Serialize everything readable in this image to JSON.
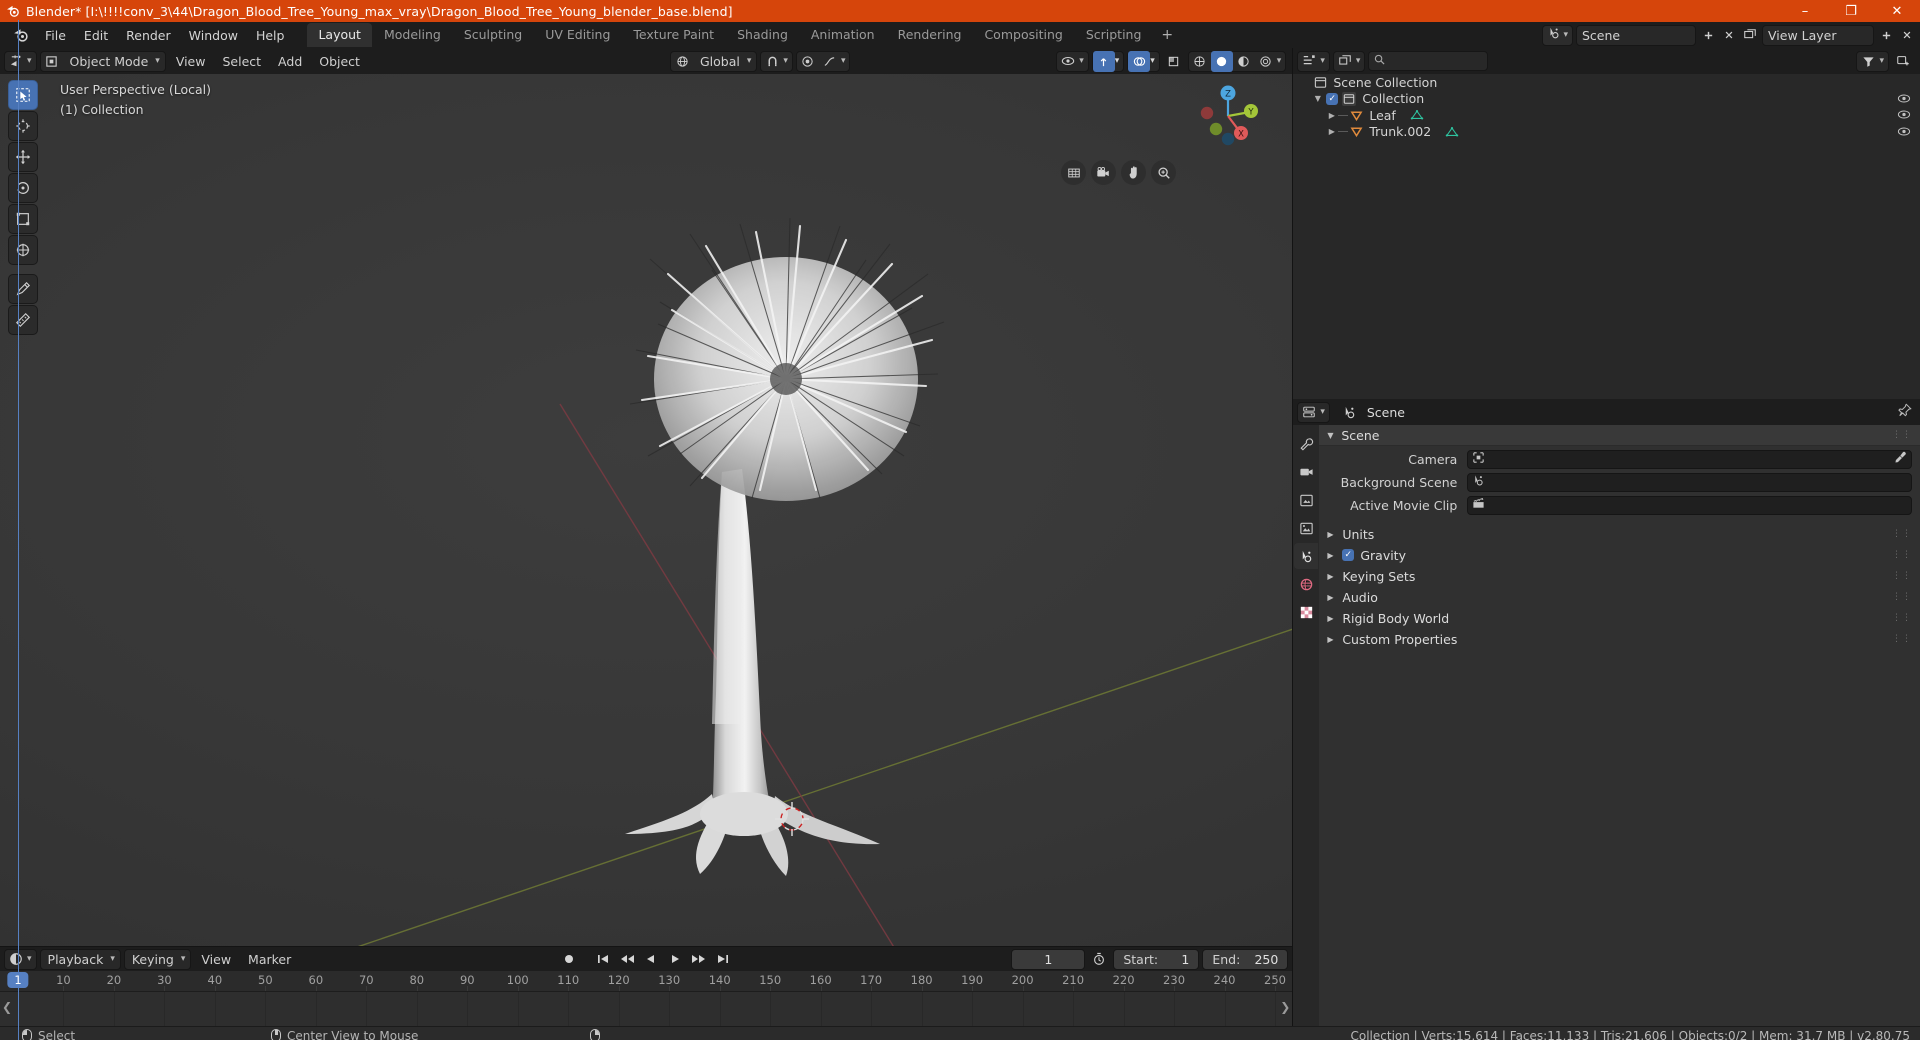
{
  "titlebar": {
    "title": "Blender* [I:\\!!!!conv_3\\44\\Dragon_Blood_Tree_Young_max_vray\\Dragon_Blood_Tree_Young_blender_base.blend]",
    "minimize": "–",
    "maximize": "❐",
    "close": "✕"
  },
  "topbar": {
    "menus": [
      "File",
      "Edit",
      "Render",
      "Window",
      "Help"
    ],
    "workspaces": [
      "Layout",
      "Modeling",
      "Sculpting",
      "UV Editing",
      "Texture Paint",
      "Shading",
      "Animation",
      "Rendering",
      "Compositing",
      "Scripting"
    ],
    "active_workspace": "Layout",
    "add_workspace": "+",
    "scene_name": "Scene",
    "view_layer_name": "View Layer",
    "new_scene": "➕",
    "unlink_scene": "✕"
  },
  "viewport": {
    "mode": "Object Mode",
    "menus": [
      "View",
      "Select",
      "Add",
      "Object"
    ],
    "transform_orientation": "Global",
    "overlay_line1": "User Perspective (Local)",
    "overlay_line2": "(1) Collection",
    "gizmo_axes": {
      "x": "X",
      "y": "Y",
      "z": "Z"
    },
    "nav_icons": [
      "grid-icon",
      "camera-icon",
      "hand-icon",
      "zoom-icon"
    ],
    "tools": [
      "select-box-tool",
      "cursor-tool",
      "move-tool",
      "rotate-tool",
      "scale-tool",
      "transform-tool",
      "annotate-tool",
      "measure-tool"
    ]
  },
  "timeline": {
    "editor_type": "timeline-editor-icon",
    "menus": [
      "Playback",
      "Keying",
      "View",
      "Marker"
    ],
    "current_frame": "1",
    "start_label": "Start:",
    "start_value": "1",
    "end_label": "End:",
    "end_value": "250",
    "ticks": [
      "1",
      "10",
      "20",
      "30",
      "40",
      "50",
      "60",
      "70",
      "80",
      "90",
      "100",
      "110",
      "120",
      "130",
      "140",
      "150",
      "160",
      "170",
      "180",
      "190",
      "200",
      "210",
      "220",
      "230",
      "240",
      "250"
    ],
    "playhead_label": "1"
  },
  "outliner": {
    "display_mode": "View Layer",
    "search_placeholder": "",
    "rows": [
      {
        "label": "Scene Collection",
        "icon": "collection-icon",
        "depth": 0,
        "expandable": false,
        "checkbox": false,
        "eye": false,
        "mesh": false
      },
      {
        "label": "Collection",
        "icon": "collection-icon",
        "depth": 1,
        "expandable": true,
        "checkbox": true,
        "eye": true,
        "mesh": false
      },
      {
        "label": "Leaf",
        "icon": "object-mesh-icon",
        "depth": 2,
        "expandable": true,
        "checkbox": false,
        "eye": true,
        "mesh": true
      },
      {
        "label": "Trunk.002",
        "icon": "object-mesh-icon",
        "depth": 2,
        "expandable": true,
        "checkbox": false,
        "eye": true,
        "mesh": true
      }
    ]
  },
  "properties": {
    "breadcrumb": "Scene",
    "panel_title": "Scene",
    "fields": [
      {
        "label": "Camera",
        "value": "",
        "icon": "camera-data-icon",
        "eyedropper": true
      },
      {
        "label": "Background Scene",
        "value": "",
        "icon": "scene-icon",
        "eyedropper": false
      },
      {
        "label": "Active Movie Clip",
        "value": "",
        "icon": "clip-icon",
        "eyedropper": false
      }
    ],
    "subpanels": [
      {
        "label": "Units",
        "checkbox": false
      },
      {
        "label": "Gravity",
        "checkbox": true
      },
      {
        "label": "Keying Sets",
        "checkbox": false
      },
      {
        "label": "Audio",
        "checkbox": false
      },
      {
        "label": "Rigid Body World",
        "checkbox": false
      },
      {
        "label": "Custom Properties",
        "checkbox": false
      }
    ],
    "tabs": [
      "tool-icon",
      "render-icon",
      "output-icon",
      "view-layer-icon",
      "scene-icon",
      "world-icon",
      "texture-icon"
    ],
    "active_tab_index": 4
  },
  "statusbar": {
    "hints": [
      {
        "mouse": "left",
        "text": "Select"
      },
      {
        "mouse": "middle",
        "text": "Center View to Mouse"
      },
      {
        "mouse": "right",
        "text": ""
      }
    ],
    "stats": "Collection | Verts:15,614 | Faces:11,133 | Tris:21,606 | Objects:0/2 | Mem: 31.7 MB | v2.80.75"
  },
  "colors": {
    "accent_orange": "#d6450b",
    "accent_blue": "#4772b3",
    "axis_x": "#e05a5a",
    "axis_y": "#a4c639",
    "axis_z": "#4da6e0",
    "mesh_icon": "#2ec4a0",
    "object_icon": "#e08a3c"
  }
}
